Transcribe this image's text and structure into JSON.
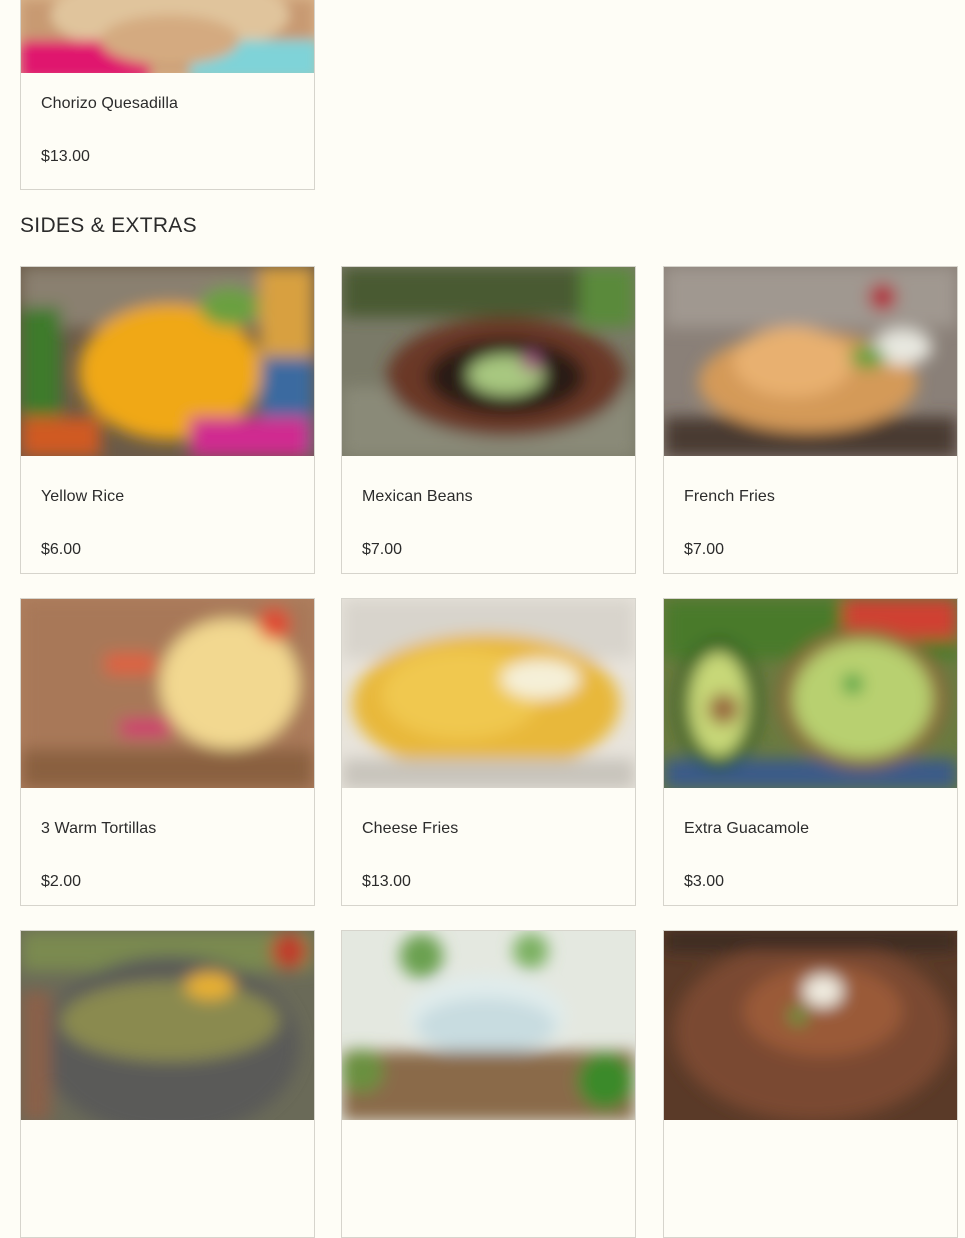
{
  "top_item": {
    "name": "Chorizo Quesadilla",
    "price": "$13.00"
  },
  "section": {
    "title": "SIDES & EXTRAS"
  },
  "items": [
    {
      "name": "Yellow Rice",
      "price": "$6.00"
    },
    {
      "name": "Mexican Beans",
      "price": "$7.00"
    },
    {
      "name": "French Fries",
      "price": "$7.00"
    },
    {
      "name": "3 Warm Tortillas",
      "price": "$2.00"
    },
    {
      "name": "Cheese Fries",
      "price": "$13.00"
    },
    {
      "name": "Extra Guacamole",
      "price": "$3.00"
    },
    {
      "name": "",
      "price": ""
    },
    {
      "name": "",
      "price": ""
    },
    {
      "name": "",
      "price": ""
    }
  ]
}
